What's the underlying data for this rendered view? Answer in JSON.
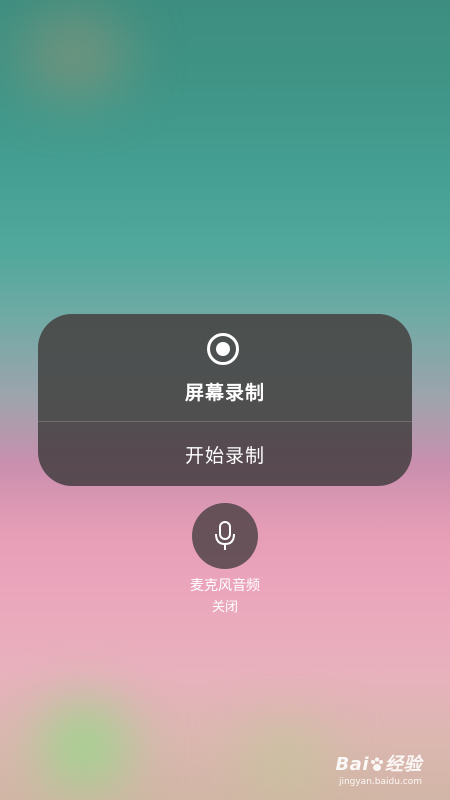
{
  "screen_recording": {
    "icon": "record-icon",
    "title": "屏幕录制",
    "start_label": "开始录制"
  },
  "microphone": {
    "icon": "microphone-icon",
    "label": "麦克风音频",
    "status": "关闭"
  },
  "watermark": {
    "logo_text": "Bai",
    "logo_suffix": "经验",
    "url": "jingyan.baidu.com"
  },
  "colors": {
    "panel": "#3e3a3c",
    "text": "#ffffff"
  }
}
